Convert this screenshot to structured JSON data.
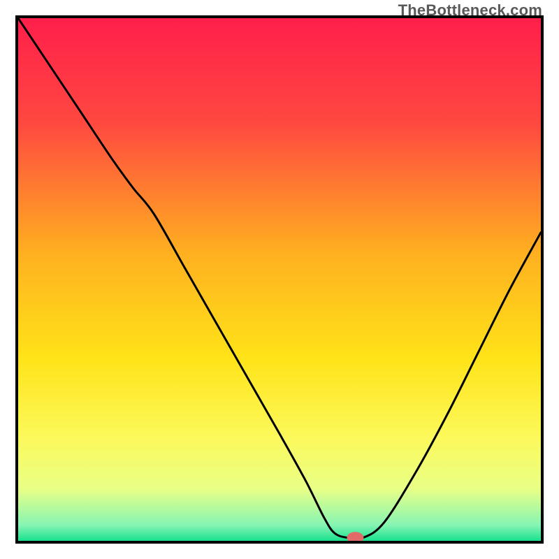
{
  "watermark": "TheBottleneck.com",
  "chart_data": {
    "type": "line",
    "title": "",
    "xlabel": "",
    "ylabel": "",
    "xlim": [
      0,
      100
    ],
    "ylim": [
      0,
      100
    ],
    "grid": false,
    "legend": false,
    "background_gradient_stops": [
      {
        "offset": 0.0,
        "color": "#ff1f4b"
      },
      {
        "offset": 0.2,
        "color": "#ff4840"
      },
      {
        "offset": 0.45,
        "color": "#ffb020"
      },
      {
        "offset": 0.65,
        "color": "#ffe318"
      },
      {
        "offset": 0.8,
        "color": "#fcf95a"
      },
      {
        "offset": 0.9,
        "color": "#e9ff86"
      },
      {
        "offset": 0.97,
        "color": "#86f5b3"
      },
      {
        "offset": 1.0,
        "color": "#19e08e"
      }
    ],
    "series": [
      {
        "name": "bottleneck-curve",
        "color": "#000000",
        "x": [
          0.0,
          6.0,
          12.0,
          18.0,
          22.0,
          26.0,
          32.0,
          38.0,
          44.0,
          50.0,
          55.0,
          58.5,
          60.5,
          63.0,
          66.0,
          70.0,
          76.0,
          82.0,
          88.0,
          94.0,
          100.0
        ],
        "y": [
          100.0,
          91.0,
          82.0,
          73.0,
          67.5,
          62.5,
          52.0,
          41.5,
          31.0,
          20.5,
          11.5,
          4.5,
          1.5,
          0.6,
          0.6,
          3.5,
          13.0,
          24.0,
          36.0,
          48.0,
          59.0
        ]
      }
    ],
    "marker": {
      "name": "optimal-point",
      "cx": 64.5,
      "cy": 0.6,
      "rx": 1.6,
      "ry": 1.1,
      "color": "#e46a6a"
    }
  }
}
